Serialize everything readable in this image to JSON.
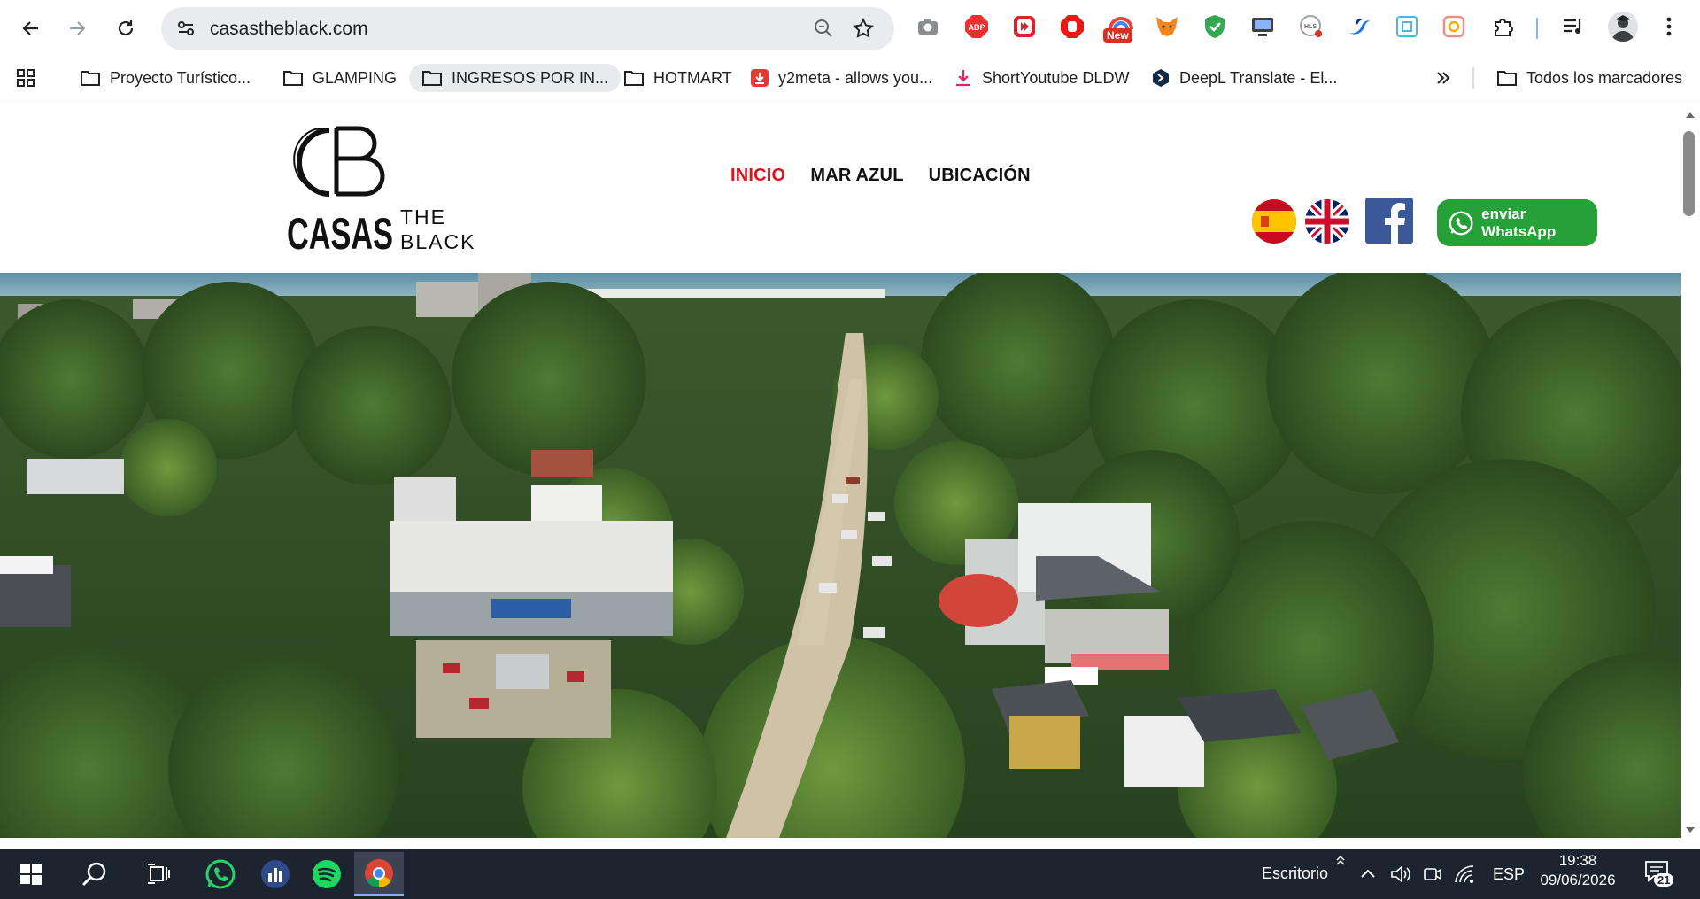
{
  "browser": {
    "url": "casastheblack.com",
    "bookmarks": [
      {
        "label": "Proyecto Turístico...",
        "icon": "folder-icon"
      },
      {
        "label": "GLAMPING",
        "icon": "folder-icon"
      },
      {
        "label": "INGRESOS POR IN...",
        "icon": "folder-icon"
      },
      {
        "label": "HOTMART",
        "icon": "folder-icon"
      },
      {
        "label": "y2meta - allows you...",
        "icon": "y2meta-icon"
      },
      {
        "label": "ShortYoutube DLDW",
        "icon": "download-icon"
      },
      {
        "label": "DeepL Translate - El...",
        "icon": "deepl-icon"
      }
    ],
    "all_bookmarks": "Todos los marcadores",
    "extension_badge": "New",
    "adblock_label": "ABP",
    "hls_label": "HLS"
  },
  "site": {
    "logo": {
      "monogram": "CB",
      "word1": "CASAS",
      "word2a": "THE",
      "word2b": "BLACK"
    },
    "nav": [
      {
        "label": "INICIO",
        "active": true
      },
      {
        "label": "MAR AZUL",
        "active": false
      },
      {
        "label": "UBICACIÓN",
        "active": false
      }
    ],
    "whatsapp_label": "enviar WhatsApp",
    "colors": {
      "accent": "#e1101c",
      "whatsapp": "#25a138",
      "facebook": "#3b5998"
    }
  },
  "taskbar": {
    "desktop_label": "Escritorio",
    "language": "ESP",
    "time": "19:38",
    "date": "09/06/2026",
    "notifications": "21"
  }
}
